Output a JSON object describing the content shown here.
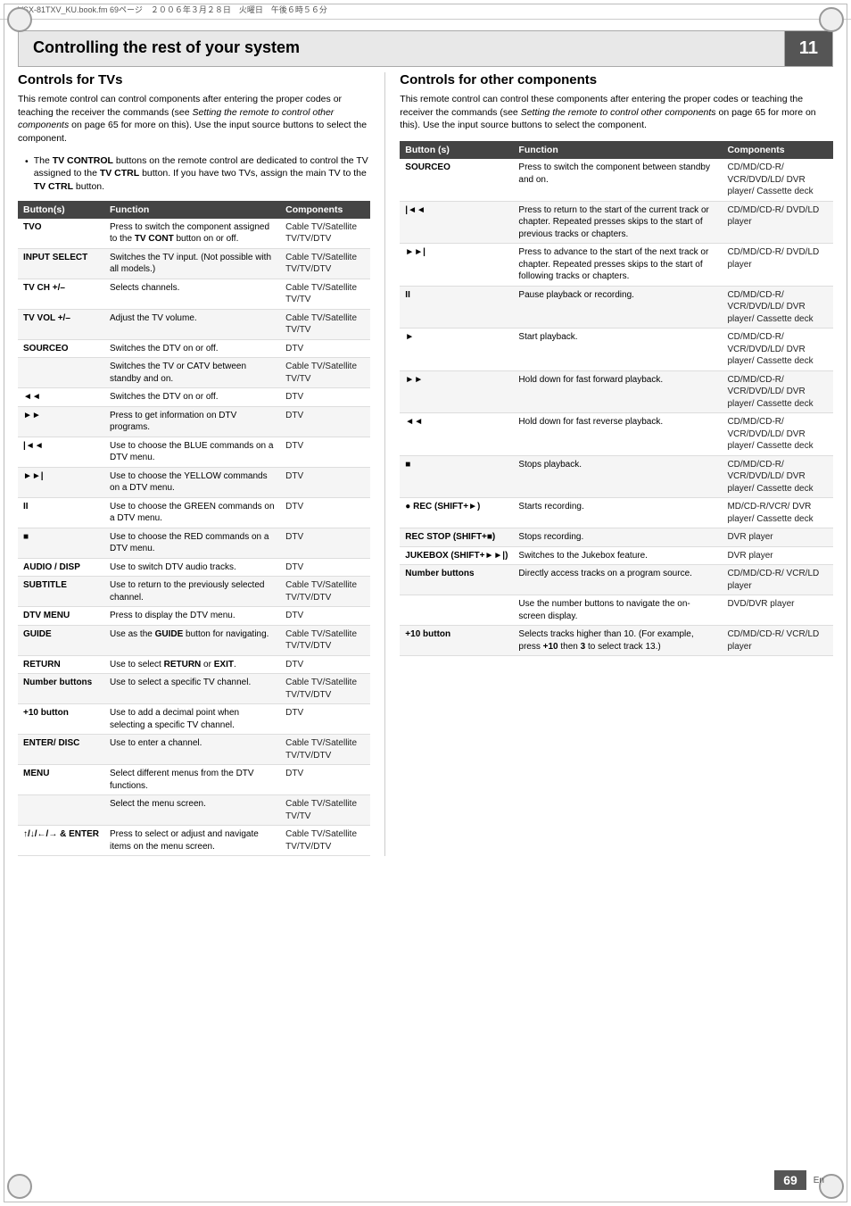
{
  "meta_bar": "VSX-81TXV_KU.book.fm 69ページ　２００６年３月２８日　火曜日　午後６時５６分",
  "page_title": "Controlling the rest of your system",
  "page_number_header": "11",
  "page_number_footer": "69",
  "footer_lang": "En",
  "left_section": {
    "title": "Controls for TVs",
    "description": "This remote control can control components after entering the proper codes or teaching the receiver the commands (see Setting the remote to control other components on page 65 for more on this). Use the input source buttons to select the component.",
    "bullet": "The TV CONTROL buttons on the remote control are dedicated to control the TV assigned to the TV CTRL button. If you have two TVs, assign the main TV to the TV CTRL button.",
    "table_headers": [
      "Button(s)",
      "Function",
      "Components"
    ],
    "table_rows": [
      [
        "TVO",
        "Press to switch the component assigned to the TV CONT button on or off.",
        "Cable TV/Satellite TV/TV/DTV"
      ],
      [
        "INPUT SELECT",
        "Switches the TV input. (Not possible with all models.)",
        "Cable TV/Satellite TV/TV/DTV"
      ],
      [
        "TV CH +/–",
        "Selects channels.",
        "Cable TV/Satellite TV/TV"
      ],
      [
        "TV VOL +/–",
        "Adjust the TV volume.",
        "Cable TV/Satellite TV/TV"
      ],
      [
        "SOURCEO",
        "Switches the DTV on or off.",
        "DTV"
      ],
      [
        "",
        "Switches the TV or CATV between standby and on.",
        "Cable TV/Satellite TV/TV"
      ],
      [
        "◄◄",
        "Switches the DTV on or off.",
        "DTV"
      ],
      [
        "►►",
        "Press to get information on DTV programs.",
        "DTV"
      ],
      [
        "|◄◄",
        "Use to choose the BLUE commands on a DTV menu.",
        "DTV"
      ],
      [
        "►►|",
        "Use to choose the YELLOW commands on a DTV menu.",
        "DTV"
      ],
      [
        "II",
        "Use to choose the GREEN commands on a DTV menu.",
        "DTV"
      ],
      [
        "■",
        "Use to choose the RED commands on a DTV menu.",
        "DTV"
      ],
      [
        "AUDIO / DISP",
        "Use to switch DTV audio tracks.",
        "DTV"
      ],
      [
        "SUBTITLE",
        "Use to return to the previously selected channel.",
        "Cable TV/Satellite TV/TV/DTV"
      ],
      [
        "DTV MENU",
        "Press to display the DTV menu.",
        "DTV"
      ],
      [
        "GUIDE",
        "Use as the GUIDE button for navigating.",
        "Cable TV/Satellite TV/TV/DTV"
      ],
      [
        "RETURN",
        "Use to select RETURN or EXIT.",
        "DTV"
      ],
      [
        "Number buttons",
        "Use to select a specific TV channel.",
        "Cable TV/Satellite TV/TV/DTV"
      ],
      [
        "+10 button",
        "Use to add a decimal point when selecting a specific TV channel.",
        "DTV"
      ],
      [
        "ENTER/ DISC",
        "Use to enter a channel.",
        "Cable TV/Satellite TV/TV/DTV"
      ],
      [
        "MENU",
        "Select different menus from the DTV functions.",
        "DTV"
      ],
      [
        "",
        "Select the menu screen.",
        "Cable TV/Satellite TV/TV"
      ],
      [
        "↑/↓/←/→ & ENTER",
        "Press to select or adjust and navigate items on the menu screen.",
        "Cable TV/Satellite TV/TV/DTV"
      ]
    ]
  },
  "right_section": {
    "title": "Controls for other components",
    "description": "This remote control can control these components after entering the proper codes or teaching the receiver the commands (see Setting the remote to control other components on page 65 for more on this). Use the input source buttons to select the component.",
    "table_headers": [
      "Button (s)",
      "Function",
      "Components"
    ],
    "table_rows": [
      [
        "SOURCEO",
        "Press to switch the component between standby and on.",
        "CD/MD/CD-R/ VCR/DVD/LD/ DVR player/ Cassette deck"
      ],
      [
        "|◄◄",
        "Press to return to the start of the current track or chapter. Repeated presses skips to the start of previous tracks or chapters.",
        "CD/MD/CD-R/ DVD/LD player"
      ],
      [
        "►►|",
        "Press to advance to the start of the next track or chapter. Repeated presses skips to the start of following tracks or chapters.",
        "CD/MD/CD-R/ DVD/LD player"
      ],
      [
        "II",
        "Pause playback or recording.",
        "CD/MD/CD-R/ VCR/DVD/LD/ DVR player/ Cassette deck"
      ],
      [
        "►",
        "Start playback.",
        "CD/MD/CD-R/ VCR/DVD/LD/ DVR player/ Cassette deck"
      ],
      [
        "►►",
        "Hold down for fast forward playback.",
        "CD/MD/CD-R/ VCR/DVD/LD/ DVR player/ Cassette deck"
      ],
      [
        "◄◄",
        "Hold down for fast reverse playback.",
        "CD/MD/CD-R/ VCR/DVD/LD/ DVR player/ Cassette deck"
      ],
      [
        "■",
        "Stops playback.",
        "CD/MD/CD-R/ VCR/DVD/LD/ DVR player/ Cassette deck"
      ],
      [
        "● REC (SHIFT+►)",
        "Starts recording.",
        "MD/CD-R/VCR/ DVR player/ Cassette deck"
      ],
      [
        "REC STOP (SHIFT+■)",
        "Stops recording.",
        "DVR player"
      ],
      [
        "JUKEBOX (SHIFT+►►|)",
        "Switches to the Jukebox feature.",
        "DVR player"
      ],
      [
        "Number buttons",
        "Directly access tracks on a program source.",
        "CD/MD/CD-R/ VCR/LD player"
      ],
      [
        "",
        "Use the number buttons to navigate the on-screen display.",
        "DVD/DVR player"
      ],
      [
        "+10 button",
        "Selects tracks higher than 10. (For example, press +10 then 3 to select track 13.)",
        "CD/MD/CD-R/ VCR/LD player"
      ]
    ]
  }
}
